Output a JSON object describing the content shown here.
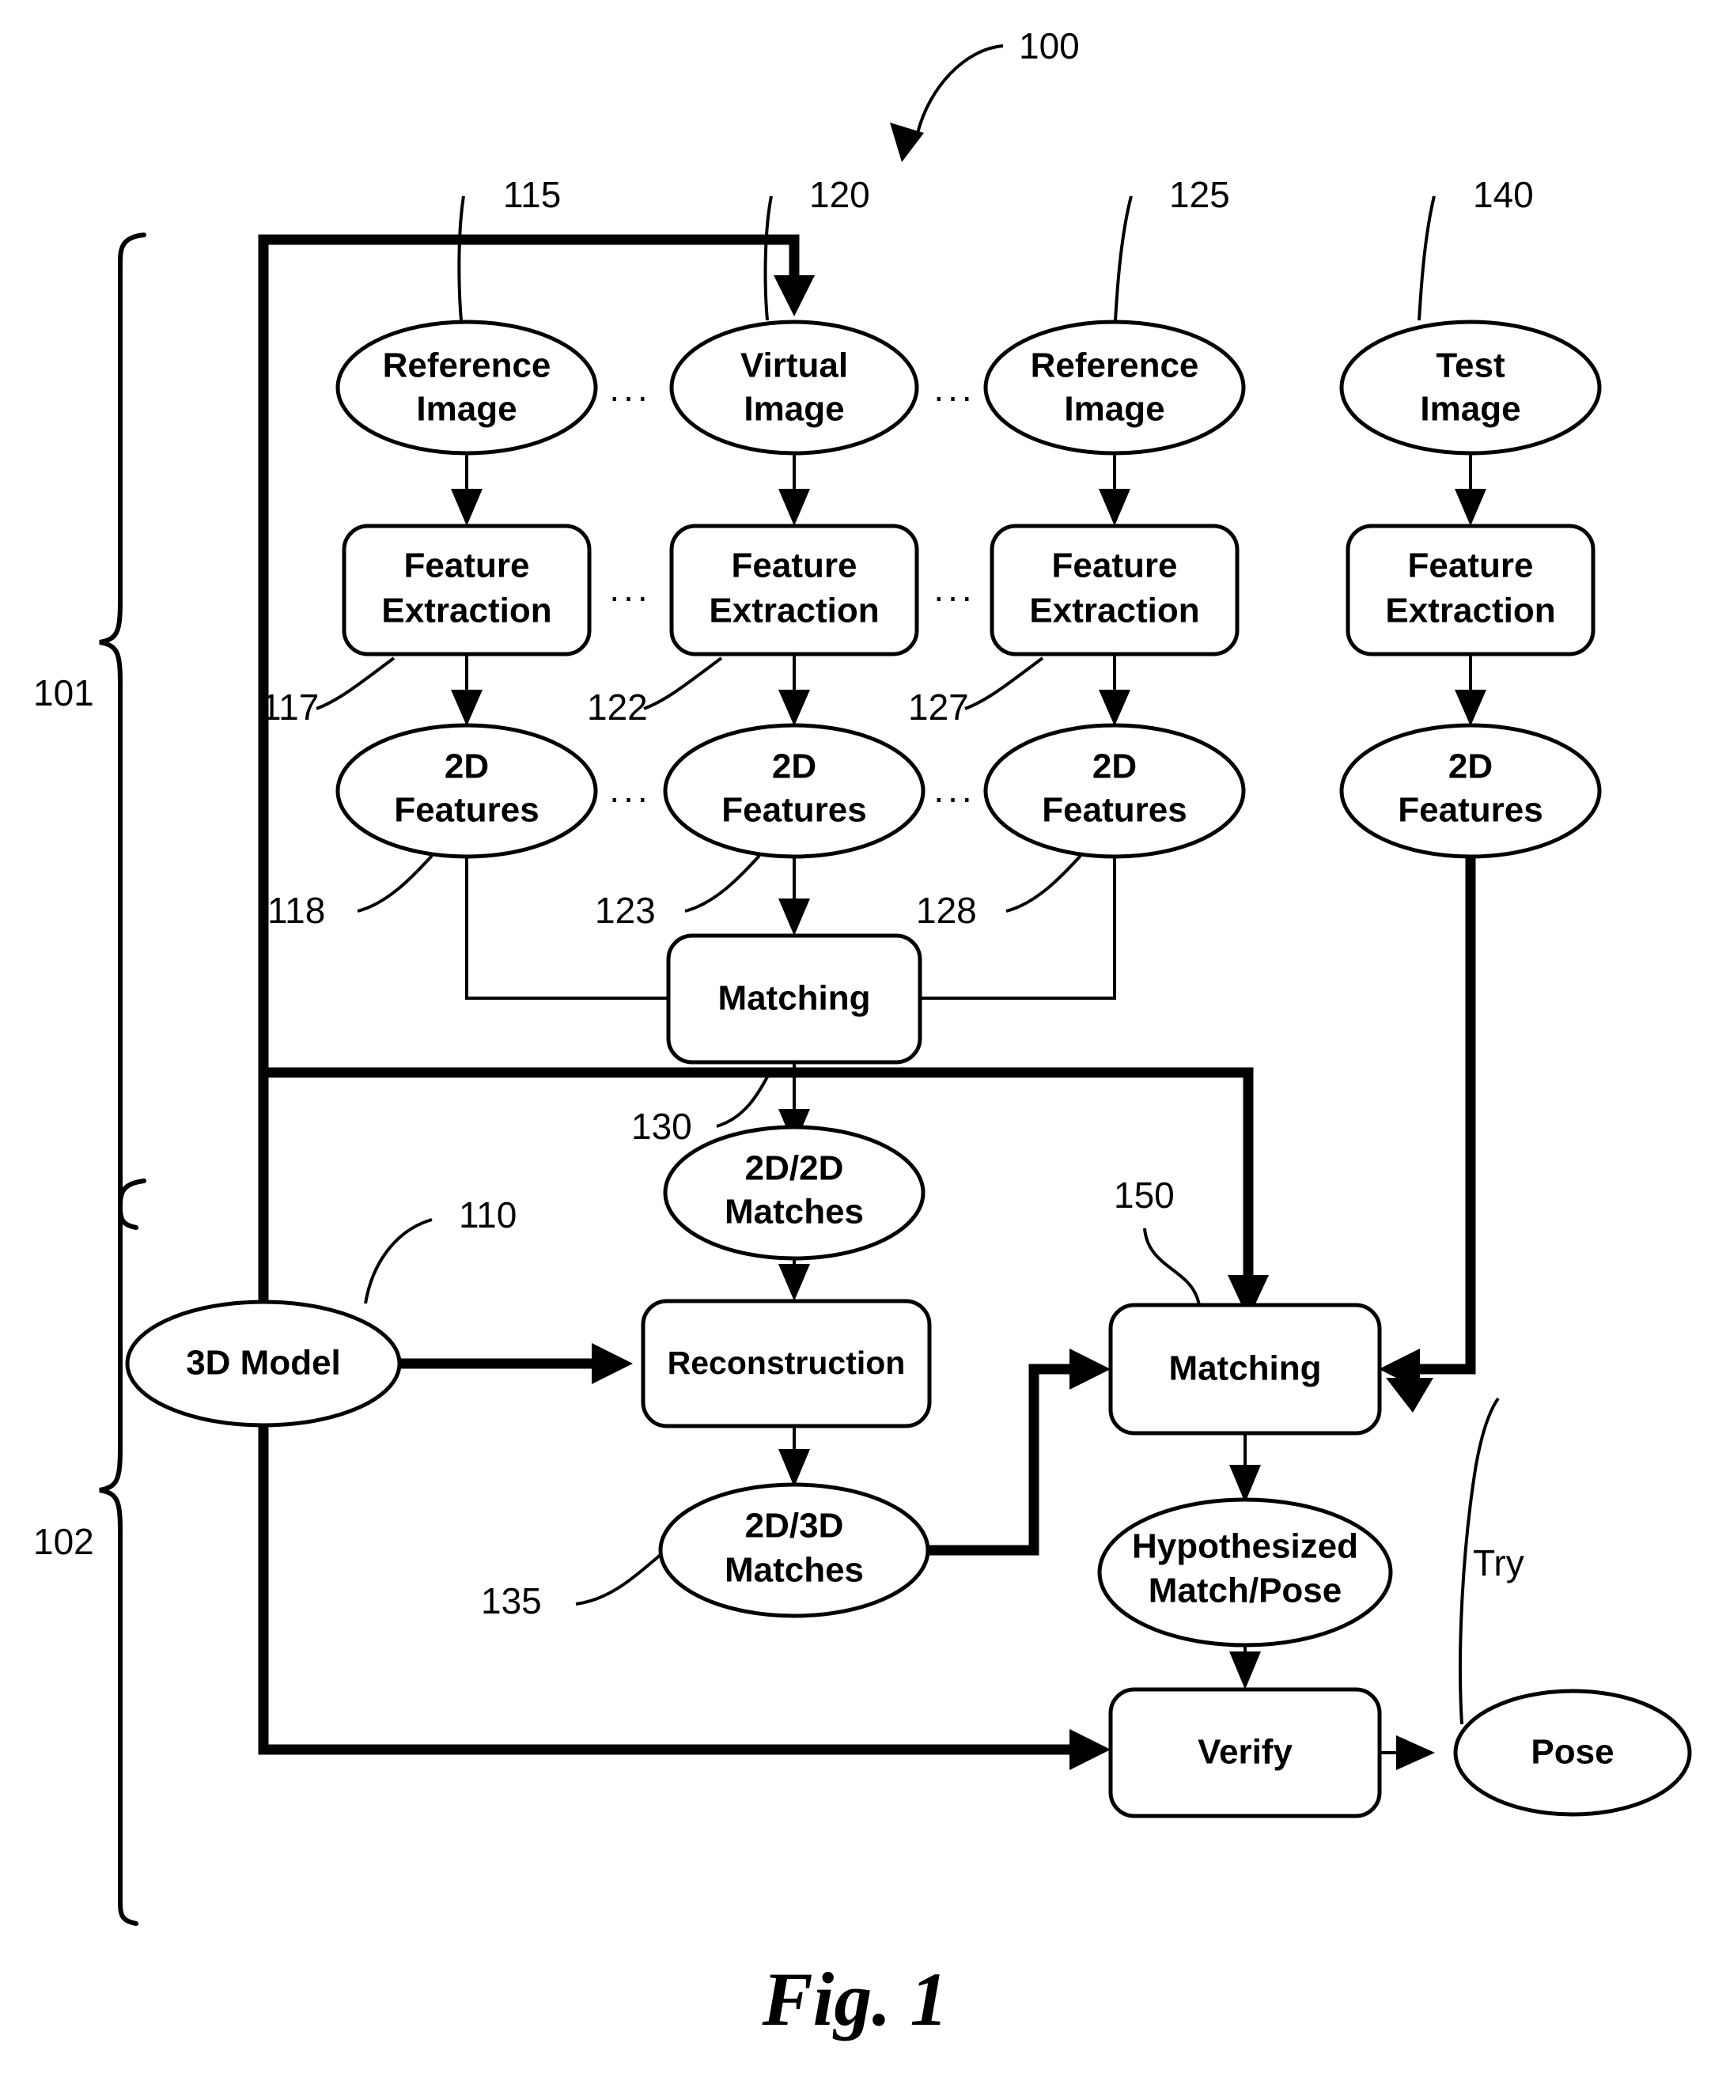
{
  "figure": {
    "caption": "Fig. 1",
    "system_ref": "100"
  },
  "braces": [
    {
      "label": "101",
      "name": "offline-stage-brace"
    },
    {
      "label": "102",
      "name": "online-stage-brace"
    }
  ],
  "columns": [
    {
      "id": "col-ref-1",
      "source": {
        "label": "Reference\nImage",
        "line1": "Reference",
        "line2": "Image",
        "ref": "115"
      },
      "process": {
        "label": "Feature\nExtraction",
        "line1": "Feature",
        "line2": "Extraction",
        "ref": "117"
      },
      "output": {
        "label": "2D\nFeatures",
        "line1": "2D",
        "line2": "Features",
        "ref": "118"
      }
    },
    {
      "id": "col-virtual",
      "source": {
        "label": "Virtual\nImage",
        "line1": "Virtual",
        "line2": "Image",
        "ref": "120"
      },
      "process": {
        "label": "Feature\nExtraction",
        "line1": "Feature",
        "line2": "Extraction",
        "ref": "122"
      },
      "output": {
        "label": "2D\nFeatures",
        "line1": "2D",
        "line2": "Features",
        "ref": "123"
      }
    },
    {
      "id": "col-ref-2",
      "source": {
        "label": "Reference\nImage",
        "line1": "Reference",
        "line2": "Image",
        "ref": "125"
      },
      "process": {
        "label": "Feature\nExtraction",
        "line1": "Feature",
        "line2": "Extraction",
        "ref": "127"
      },
      "output": {
        "label": "2D\nFeatures",
        "line1": "2D",
        "line2": "Features",
        "ref": "128"
      }
    },
    {
      "id": "col-test",
      "source": {
        "label": "Test\nImage",
        "line1": "Test",
        "line2": "Image",
        "ref": "140"
      },
      "process": {
        "label": "Feature\nExtraction",
        "line1": "Feature",
        "line2": "Extraction",
        "ref": ""
      },
      "output": {
        "label": "2D\nFeatures",
        "line1": "2D",
        "line2": "Features",
        "ref": ""
      }
    }
  ],
  "ellipsis": "...",
  "nodes": {
    "matching_top": {
      "label": "Matching",
      "ref": ""
    },
    "matches_2d2d": {
      "line1": "2D/2D",
      "line2": "Matches",
      "ref": "130"
    },
    "model_3d": {
      "label": "3D Model",
      "ref": "110"
    },
    "reconstruction": {
      "label": "Reconstruction",
      "ref": ""
    },
    "matches_2d3d": {
      "line1": "2D/3D",
      "line2": "Matches",
      "ref": "135"
    },
    "matching_bottom": {
      "label": "Matching",
      "ref": "150"
    },
    "hypothesized": {
      "line1": "Hypothesized",
      "line2": "Match/Pose",
      "ref": ""
    },
    "verify": {
      "label": "Verify",
      "ref": ""
    },
    "pose": {
      "label": "Pose",
      "ref": ""
    }
  },
  "edge_labels": {
    "try": "Try"
  }
}
